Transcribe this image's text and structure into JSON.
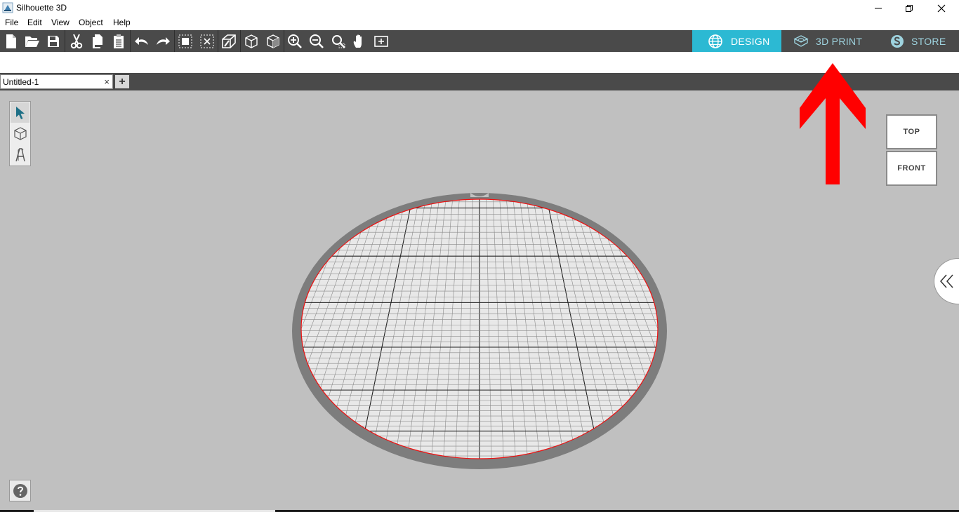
{
  "window": {
    "title": "Silhouette 3D",
    "minimize_icon": "minimize-icon",
    "restore_icon": "restore-icon",
    "close_icon": "close-icon"
  },
  "menu": {
    "items": [
      "File",
      "Edit",
      "View",
      "Object",
      "Help"
    ]
  },
  "toolbar": {
    "icons": [
      "new-document-icon",
      "open-folder-icon",
      "save-icon",
      "cut-icon",
      "copy-icon",
      "paste-icon",
      "undo-icon",
      "redo-icon",
      "group-icon",
      "ungroup-icon",
      "extrude-icon",
      "cube-wire-icon",
      "cube-solid-icon",
      "zoom-in-icon",
      "zoom-out-icon",
      "zoom-fit-icon",
      "pan-hand-icon",
      "fit-page-icon"
    ]
  },
  "mode_tabs": {
    "design": "DESIGN",
    "print": "3D PRINT",
    "store": "STORE",
    "active": "design",
    "active_color": "#2cb9d3"
  },
  "document": {
    "tab_name": "Untitled-1",
    "close_glyph": "×",
    "add_glyph": "+"
  },
  "tools": [
    "select-arrow-icon",
    "cube-icon",
    "text-tool-icon"
  ],
  "view_cube": {
    "top": "TOP",
    "front": "FRONT"
  },
  "side_toggle_glyph": "«",
  "help_glyph": "?",
  "annotation": {
    "arrow_color": "#ff0000",
    "points_to": "3D PRINT"
  }
}
